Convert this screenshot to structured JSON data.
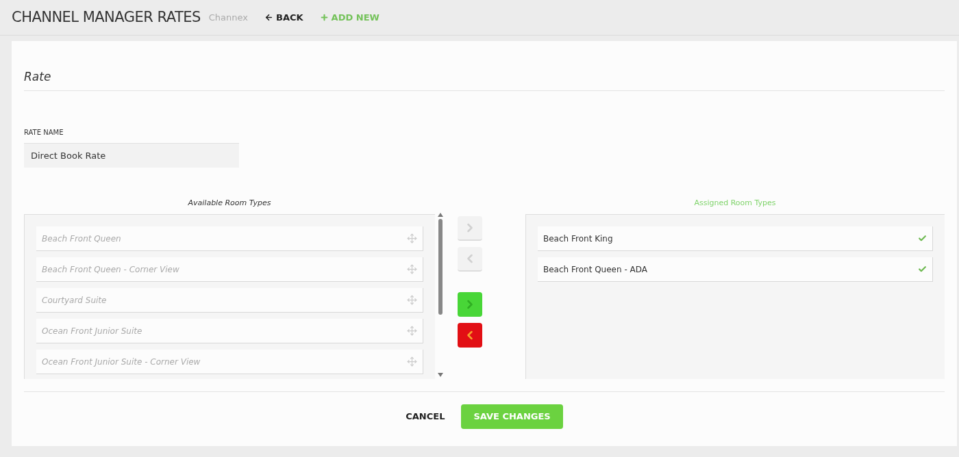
{
  "header": {
    "title": "CHANNEL MANAGER RATES",
    "subtitle": "Channex",
    "back": "BACK",
    "add_new": "ADD NEW"
  },
  "section_title": "Rate",
  "rate_name": {
    "label": "RATE NAME",
    "value": "Direct Book Rate"
  },
  "available": {
    "heading": "Available Room Types",
    "items": [
      "Beach Front Queen",
      "Beach Front Queen - Corner View",
      "Courtyard Suite",
      "Ocean Front Junior Suite",
      "Ocean Front Junior Suite - Corner View"
    ]
  },
  "transfer_buttons": [
    {
      "kind": "right",
      "disabled": true
    },
    {
      "kind": "left",
      "disabled": true
    },
    {
      "kind": "right",
      "disabled": false
    },
    {
      "kind": "left",
      "disabled": false
    }
  ],
  "assigned": {
    "heading": "Assigned Room Types",
    "items": [
      "Beach Front King",
      "Beach Front Queen - ADA"
    ]
  },
  "footer": {
    "cancel": "CANCEL",
    "save": "SAVE CHANGES"
  }
}
